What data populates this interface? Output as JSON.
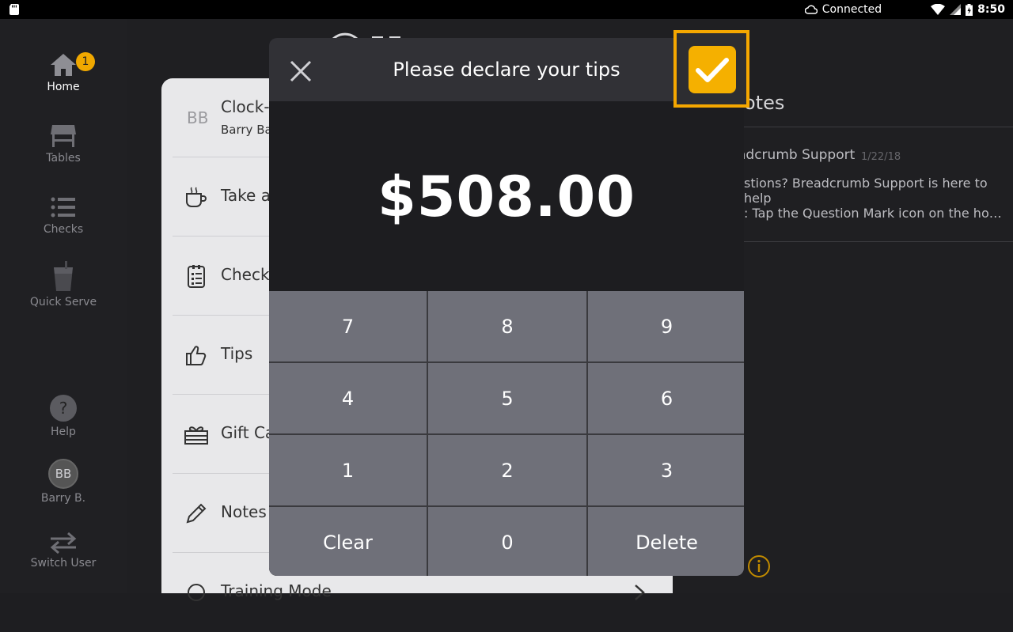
{
  "status_bar": {
    "connection": "Connected",
    "time": "8:50"
  },
  "rail": {
    "home": "Home",
    "home_badge": "1",
    "tables": "Tables",
    "checks": "Checks",
    "quick_serve": "Quick Serve",
    "help": "Help",
    "user_initials": "BB",
    "user_name": "Barry B.",
    "switch_user": "Switch User"
  },
  "menu": {
    "user_initials": "BB",
    "clock_title": "Clock-O",
    "clock_sub": "Barry Ba",
    "items": [
      {
        "label": "Take a"
      },
      {
        "label": "Checko"
      },
      {
        "label": "Tips"
      },
      {
        "label": "Gift Ca"
      },
      {
        "label": "Notes"
      },
      {
        "label": "Training Mode"
      }
    ]
  },
  "notes": {
    "header": "otes",
    "item_title": "adcrumb Support",
    "item_date": "1/22/18",
    "line1": "stions? Breadcrumb Support is here to help",
    "line2": ": Tap the Question Mark icon on the home sc..."
  },
  "modal": {
    "title": "Please declare your tips",
    "amount": "$508.00",
    "keys": [
      "7",
      "8",
      "9",
      "4",
      "5",
      "6",
      "1",
      "2",
      "3",
      "Clear",
      "0",
      "Delete"
    ]
  },
  "colors": {
    "accent": "#f5b000",
    "keypad": "#6f7079",
    "modal_header": "#313136"
  }
}
